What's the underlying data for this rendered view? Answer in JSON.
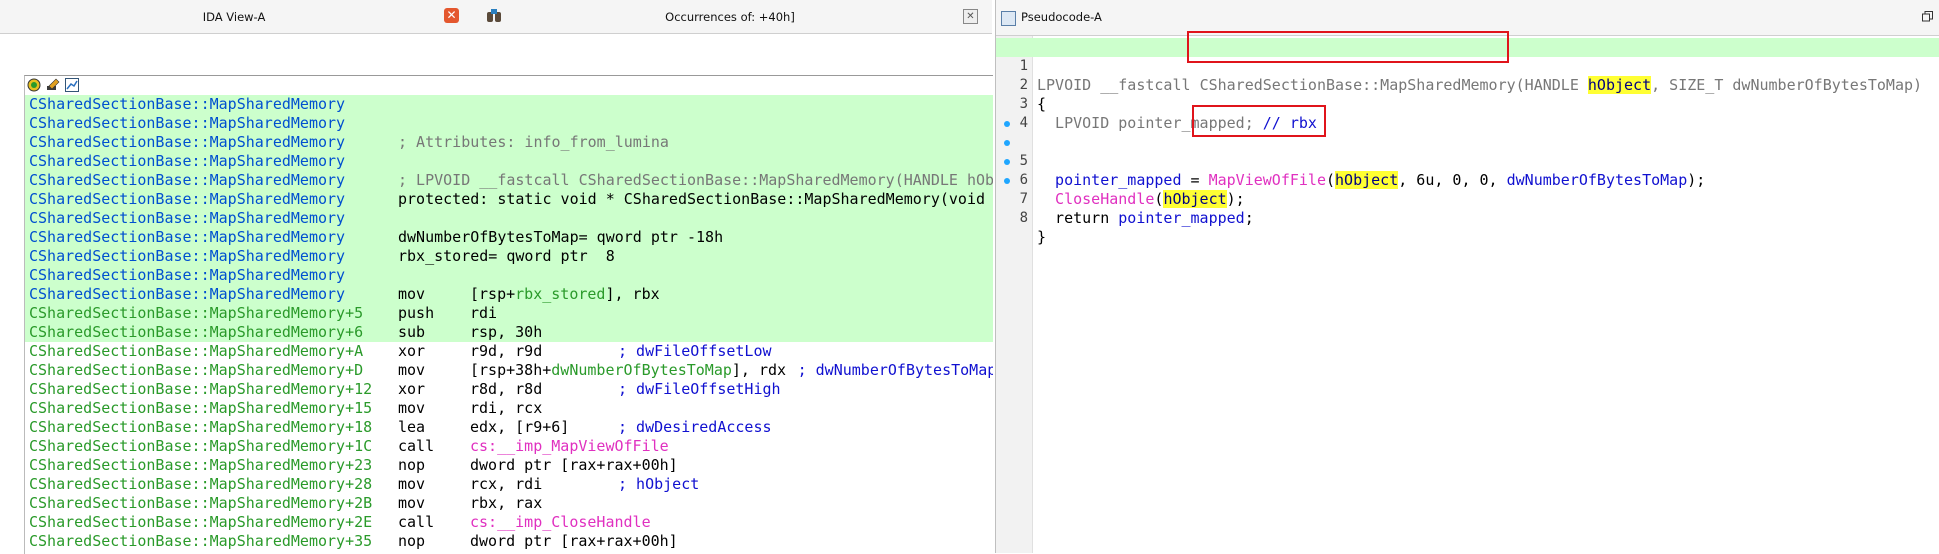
{
  "left": {
    "tab_ida": "IDA View-A",
    "tab_occ": "Occurrences of: +40h]",
    "close_x": "✕",
    "listing_rows": [
      {
        "addr": "CSharedSectionBase::MapSharedMemory",
        "hl": true,
        "a": "",
        "b": "",
        "c": ""
      },
      {
        "addr": "CSharedSectionBase::MapSharedMemory",
        "hl": true,
        "a": "",
        "b": "",
        "c": ""
      },
      {
        "addr": "CSharedSectionBase::MapSharedMemory",
        "hl": true,
        "a": "; Attributes: info_from_lumina",
        "b": "",
        "c": ""
      },
      {
        "addr": "CSharedSectionBase::MapSharedMemory",
        "hl": true,
        "a": "",
        "b": "",
        "c": ""
      },
      {
        "addr": "CSharedSectionBase::MapSharedMemory",
        "hl": true,
        "a": "; LPVOID __fastcall CSharedSectionBase::MapSharedMemory(HANDLE hOb",
        "b": "",
        "c": ""
      },
      {
        "addr": "CSharedSectionBase::MapSharedMemory",
        "hl": true,
        "a": "protected: static void * CSharedSectionBase::MapSharedMemory(void",
        "b": "",
        "c": ""
      },
      {
        "addr": "CSharedSectionBase::MapSharedMemory",
        "hl": true,
        "a": "",
        "b": "",
        "c": ""
      },
      {
        "addr": "CSharedSectionBase::MapSharedMemory",
        "hl": true,
        "a": "dwNumberOfBytesToMap= qword ptr -18h",
        "b": "",
        "c": ""
      },
      {
        "addr": "CSharedSectionBase::MapSharedMemory",
        "hl": true,
        "a": "rbx_stored= qword ptr  8",
        "b": "",
        "c": ""
      },
      {
        "addr": "CSharedSectionBase::MapSharedMemory",
        "hl": true,
        "a": "",
        "b": "",
        "c": ""
      },
      {
        "addr": "CSharedSectionBase::MapSharedMemory",
        "hl": true,
        "a": "mov",
        "b": "[rsp+rbx_stored], rbx",
        "c": ""
      },
      {
        "addr": "CSharedSectionBase::MapSharedMemory+5",
        "hl": true,
        "a": "push",
        "b": "rdi",
        "c": ""
      },
      {
        "addr": "CSharedSectionBase::MapSharedMemory+6",
        "hl": true,
        "a": "sub",
        "b": "rsp, 30h",
        "c": ""
      },
      {
        "addr": "CSharedSectionBase::MapSharedMemory+A",
        "hl": false,
        "a": "xor",
        "b": "r9d, r9d",
        "c": "; dwFileOffsetLow"
      },
      {
        "addr": "CSharedSectionBase::MapSharedMemory+D",
        "hl": false,
        "a": "mov",
        "b": "[rsp+38h+dwNumberOfBytesToMap], rdx",
        "c": "; dwNumberOfBytesToMap"
      },
      {
        "addr": "CSharedSectionBase::MapSharedMemory+12",
        "hl": false,
        "a": "xor",
        "b": "r8d, r8d",
        "c": "; dwFileOffsetHigh"
      },
      {
        "addr": "CSharedSectionBase::MapSharedMemory+15",
        "hl": false,
        "a": "mov",
        "b": "rdi, rcx",
        "c": ""
      },
      {
        "addr": "CSharedSectionBase::MapSharedMemory+18",
        "hl": false,
        "a": "lea",
        "b": "edx, [r9+6]",
        "c": "; dwDesiredAccess"
      },
      {
        "addr": "CSharedSectionBase::MapSharedMemory+1C",
        "hl": false,
        "a": "call",
        "b": "cs:__imp_MapViewOfFile",
        "c": ""
      },
      {
        "addr": "CSharedSectionBase::MapSharedMemory+23",
        "hl": false,
        "a": "nop",
        "b": "dword ptr [rax+rax+00h]",
        "c": ""
      },
      {
        "addr": "CSharedSectionBase::MapSharedMemory+28",
        "hl": false,
        "a": "mov",
        "b": "rcx, rdi",
        "c": "; hObject"
      },
      {
        "addr": "CSharedSectionBase::MapSharedMemory+2B",
        "hl": false,
        "a": "mov",
        "b": "rbx, rax",
        "c": ""
      },
      {
        "addr": "CSharedSectionBase::MapSharedMemory+2E",
        "hl": false,
        "a": "call",
        "b": "cs:__imp_CloseHandle",
        "c": ""
      },
      {
        "addr": "CSharedSectionBase::MapSharedMemory+35",
        "hl": false,
        "a": "nop",
        "b": "dword ptr [rax+rax+00h]",
        "c": ""
      }
    ]
  },
  "right": {
    "tab_title": "Pseudocode-A",
    "line_numbers": [
      "1",
      "2",
      "3",
      "4",
      "5",
      "6",
      "7",
      "8"
    ],
    "l1_pre": "LPVOID __fastcall ",
    "l1_fn": "CSharedSectionBase::MapSharedMemory",
    "l1_mid": "(HANDLE ",
    "l1_hobj": "hObject",
    "l1_post": ", SIZE_T dwNumberOfBytesToMap)",
    "l2": "{",
    "l3_decl": "  LPVOID pointer_mapped; ",
    "l3_cmt": "// rbx",
    "l5_var": "  pointer_mapped",
    "l5_eq": " = ",
    "l5_fn": "MapViewOfFile",
    "l5_paren": "(",
    "l5_hobj": "hObject",
    "l5_args": ", 6u, 0, 0, ",
    "l5_n": "dwNumberOfBytesToMap",
    "l5_end": ");",
    "l6_fn": "  CloseHandle",
    "l6_paren": "(",
    "l6_hobj": "hObject",
    "l6_end": ");",
    "l7_ret": "  return ",
    "l7_var": "pointer_mapped",
    "l7_end": ";",
    "l8": "}"
  },
  "colors": {
    "highlight_green": "#ccffcc",
    "highlight_yellow": "#ffff33",
    "annotation_red": "#e0141b",
    "symbol_blue": "#1010d0",
    "function_pink": "#e030c0"
  }
}
